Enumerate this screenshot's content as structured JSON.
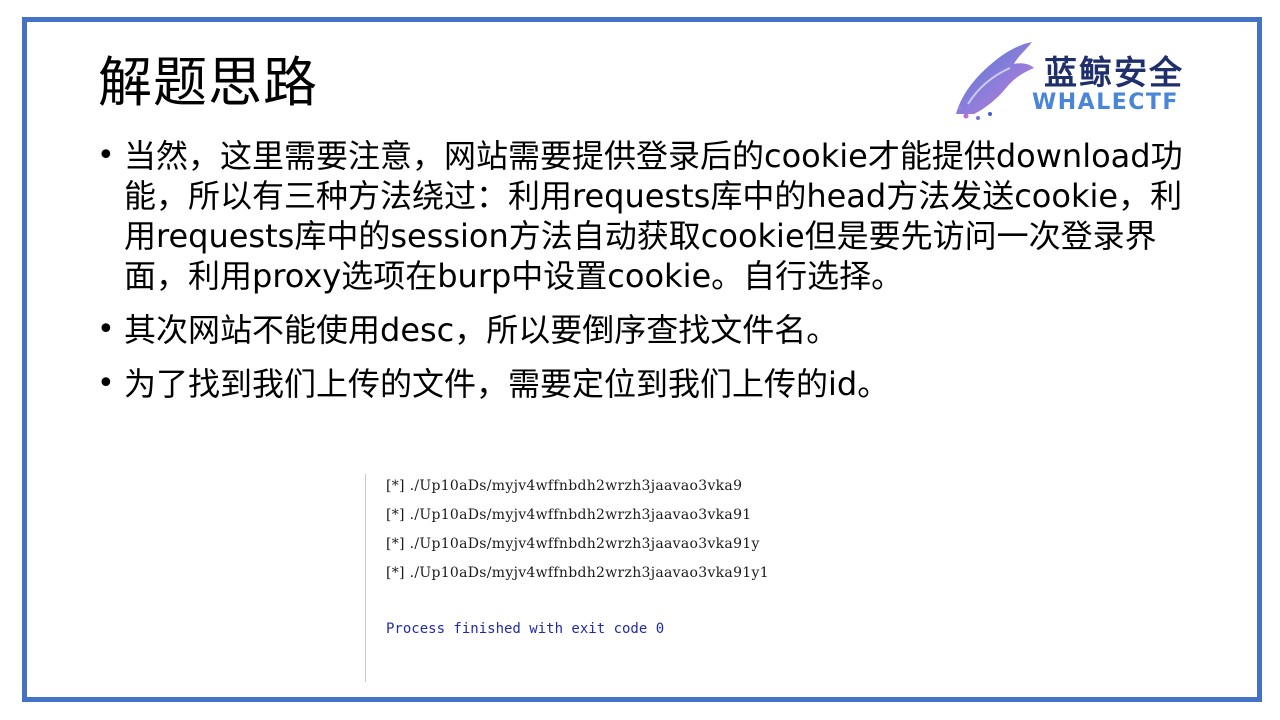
{
  "slide": {
    "title": "解题思路",
    "logo": {
      "cn_text": "蓝鲸安全",
      "en_text": "WHALECTF",
      "icon": "whale-icon"
    },
    "bullets": [
      "当然，这里需要注意，网站需要提供登录后的cookie才能提供download功能，所以有三种方法绕过：利用requests库中的head方法发送cookie，利用requests库中的session方法自动获取cookie但是要先访问一次登录界面，利用proxy选项在burp中设置cookie。自行选择。",
      "其次网站不能使用desc，所以要倒序查找文件名。",
      "为了找到我们上传的文件，需要定位到我们上传的id。"
    ]
  },
  "console": {
    "lines": [
      "[*] ./Up10aDs/myjv4wffnbdh2wrzh3jaavao3vka9",
      "[*] ./Up10aDs/myjv4wffnbdh2wrzh3jaavao3vka91",
      "[*] ./Up10aDs/myjv4wffnbdh2wrzh3jaavao3vka91y",
      "[*] ./Up10aDs/myjv4wffnbdh2wrzh3jaavao3vka91y1"
    ],
    "finished": "Process finished with exit code 0"
  },
  "colors": {
    "frame_border": "#4472c4",
    "logo_cn": "#1e2f6b",
    "logo_en": "#4a86d8",
    "console_finished": "#1f2aa8"
  }
}
